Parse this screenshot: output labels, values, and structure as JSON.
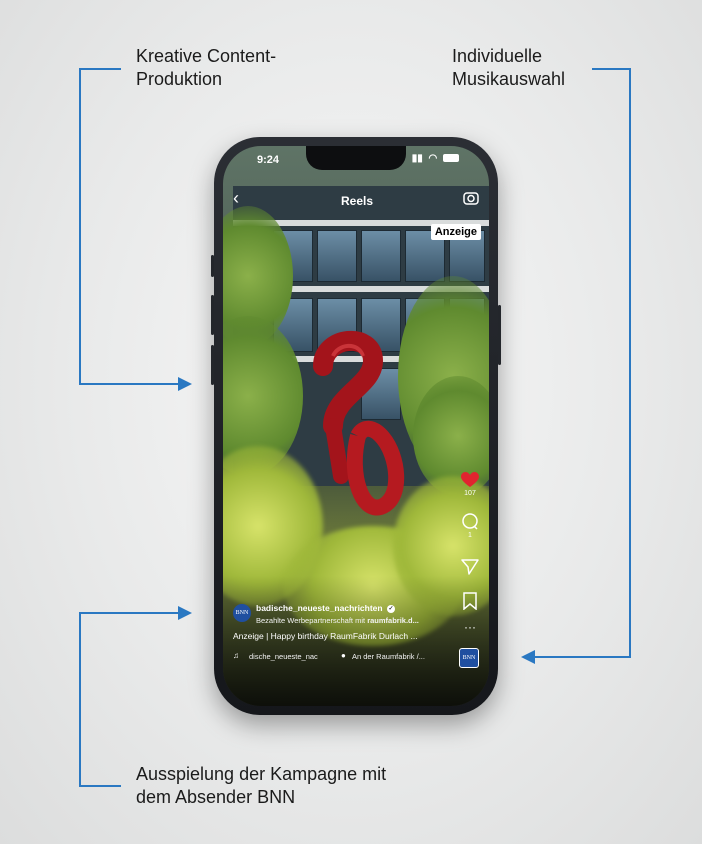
{
  "annotations": {
    "top_left": "Kreative Content-\nProduktion",
    "top_right": "Individuelle\nMusikauswahl",
    "bottom_left": "Ausspielung der Kampagne mit\ndem Absender BNN"
  },
  "phone": {
    "status_time": "9:24",
    "title": "Reels",
    "ad_badge": "Anzeige",
    "account_name": "badische_neueste_nachrichten",
    "avatar_label": "BNN",
    "sponsor_prefix": "Bezahlte Werbepartnerschaft mit",
    "sponsor_name": "raumfabrik.d...",
    "caption": "Anzeige | Happy birthday RaumFabrik Durlach ...",
    "audio": "dische_neueste_nac",
    "location": "An der Raumfabrik /...",
    "like_count": "107",
    "comment_count": "1",
    "audio_thumb_label": "BNN"
  },
  "colors": {
    "accent": "#2a78c2",
    "like": "#e0242f"
  }
}
